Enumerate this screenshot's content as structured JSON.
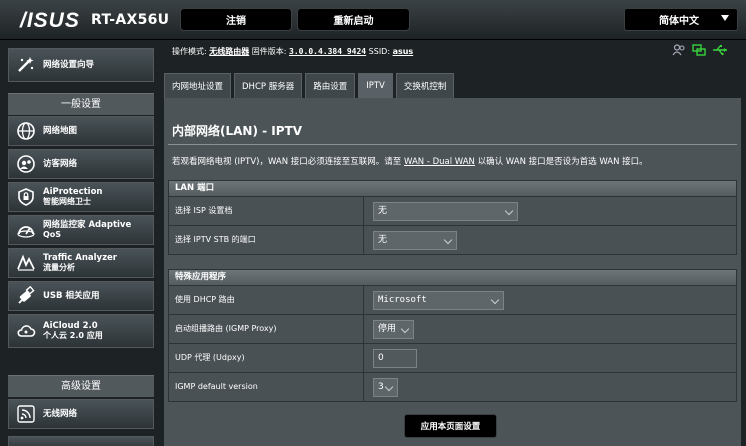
{
  "header": {
    "logo": "/ISUS",
    "model": "RT-AX56U",
    "logout": "注销",
    "reboot": "重新启动",
    "language": "简体中文"
  },
  "sidebar": {
    "quick_setup": "网络设置向导",
    "general_heading": "一般设置",
    "general_items": [
      {
        "label": "网络地图",
        "sub": "",
        "icon": "network-map-icon"
      },
      {
        "label": "访客网络",
        "sub": "",
        "icon": "guest-network-icon"
      },
      {
        "label": "AiProtection",
        "sub": "智能网络卫士",
        "icon": "shield-icon"
      },
      {
        "label": "网络监控家 Adaptive",
        "sub": "QoS",
        "icon": "speedometer-icon"
      },
      {
        "label": "Traffic Analyzer",
        "sub": "流量分析",
        "icon": "traffic-analyzer-icon"
      },
      {
        "label": "USB 相关应用",
        "sub": "",
        "icon": "usb-icon"
      },
      {
        "label": "AiCloud 2.0",
        "sub": "个人云 2.0 应用",
        "icon": "cloud-icon"
      }
    ],
    "advanced_heading": "高级设置",
    "advanced_items": [
      {
        "label": "无线网络",
        "sub": "",
        "icon": "wireless-icon"
      }
    ]
  },
  "status": {
    "mode_label": "操作模式:",
    "mode_value": "无线路由器",
    "fw_label": "固件版本:",
    "fw_value": "3.0.0.4.384_9424",
    "ssid_label": "SSID:",
    "ssid_value": "asus",
    "icons": [
      "users-icon",
      "network-status-icon",
      "usb-status-icon"
    ]
  },
  "tabs": [
    {
      "label": "内网地址设置",
      "active": false
    },
    {
      "label": "DHCP 服务器",
      "active": false
    },
    {
      "label": "路由设置",
      "active": false
    },
    {
      "label": "IPTV",
      "active": true
    },
    {
      "label": "交换机控制",
      "active": false
    }
  ],
  "page": {
    "title": "内部网络(LAN) - IPTV",
    "desc_prefix": "若观看网络电视 (IPTV)，WAN 接口必须连接至互联网。请至 ",
    "desc_link": "WAN - Dual WAN",
    "desc_suffix": " 以确认 WAN 接口是否设为首选 WAN 接口。"
  },
  "lan_port": {
    "heading": "LAN 端口",
    "isp_label": "选择 ISP 设置档",
    "isp_value": "无",
    "stb_label": "选择 IPTV STB 的端口",
    "stb_value": "无"
  },
  "special_apps": {
    "heading": "特殊应用程序",
    "dhcp_label": "使用 DHCP 路由",
    "dhcp_value": "Microsoft",
    "igmp_proxy_label": "启动组播路由 (IGMP Proxy)",
    "igmp_proxy_value": "停用",
    "udpxy_label": "UDP 代理 (Udpxy)",
    "udpxy_value": "0",
    "igmp_version_label": "IGMP default version",
    "igmp_version_value": "3"
  },
  "apply_button": "应用本页面设置",
  "colors": {
    "background": "#1d2224",
    "panel": "#4d5458",
    "usb_green": "#39d13c"
  }
}
